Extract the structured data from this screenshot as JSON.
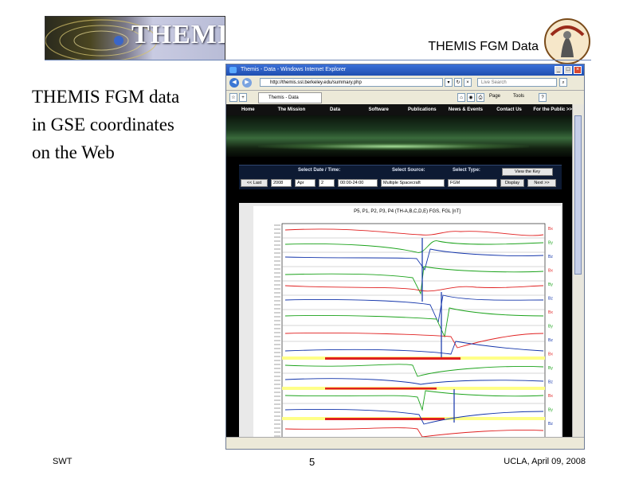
{
  "slide": {
    "logo_text": "THEMIS",
    "title": "THEMIS FGM Data",
    "body_lines": [
      "THEMIS FGM data",
      "in GSE coordinates",
      "on the Web"
    ],
    "footer_left": "SWT",
    "page_number": "5",
    "footer_right": "UCLA, April 09, 2008"
  },
  "browser": {
    "window_title": "Themis - Data - Windows Internet Explorer",
    "url": "http://themis.ssl.berkeley.edu/summary.php",
    "search_placeholder": "Live Search",
    "tab_label": "Themis - Data",
    "commands": {
      "page": "Page",
      "tools": "Tools"
    }
  },
  "site": {
    "menu": [
      "Home",
      "The Mission",
      "Data",
      "Software",
      "Publications",
      "News & Events",
      "Contact Us",
      "For the Public >>"
    ],
    "select_date_label": "Select Date / Time:",
    "select_source_label": "Select Source:",
    "select_type_label": "Select Type:",
    "view_key_button": "View the Key",
    "last_button": "<< Last",
    "year": "2008",
    "month": "Apr",
    "day": "2",
    "time_range": "00:00-24:00",
    "source": "Multiple Spacecraft",
    "type": "FGM",
    "display_button": "Display",
    "next_button": "Next >>"
  },
  "plot": {
    "title": "P5, P1, P2, P3, P4 (TH-A,B,C,D,E) FGS, FGL [nT]",
    "right_labels": [
      "Bx",
      "By",
      "Bz",
      "Bx",
      "By",
      "Bz",
      "Bx",
      "By",
      "Bz",
      "Bx",
      "By",
      "Bz",
      "Bx",
      "By",
      "Bz"
    ]
  },
  "colors": {
    "accent": "#6b84b5",
    "plot_red": "#e02020",
    "plot_green": "#1aa21a",
    "plot_blue": "#1133aa",
    "highlight": "#ffff88"
  }
}
